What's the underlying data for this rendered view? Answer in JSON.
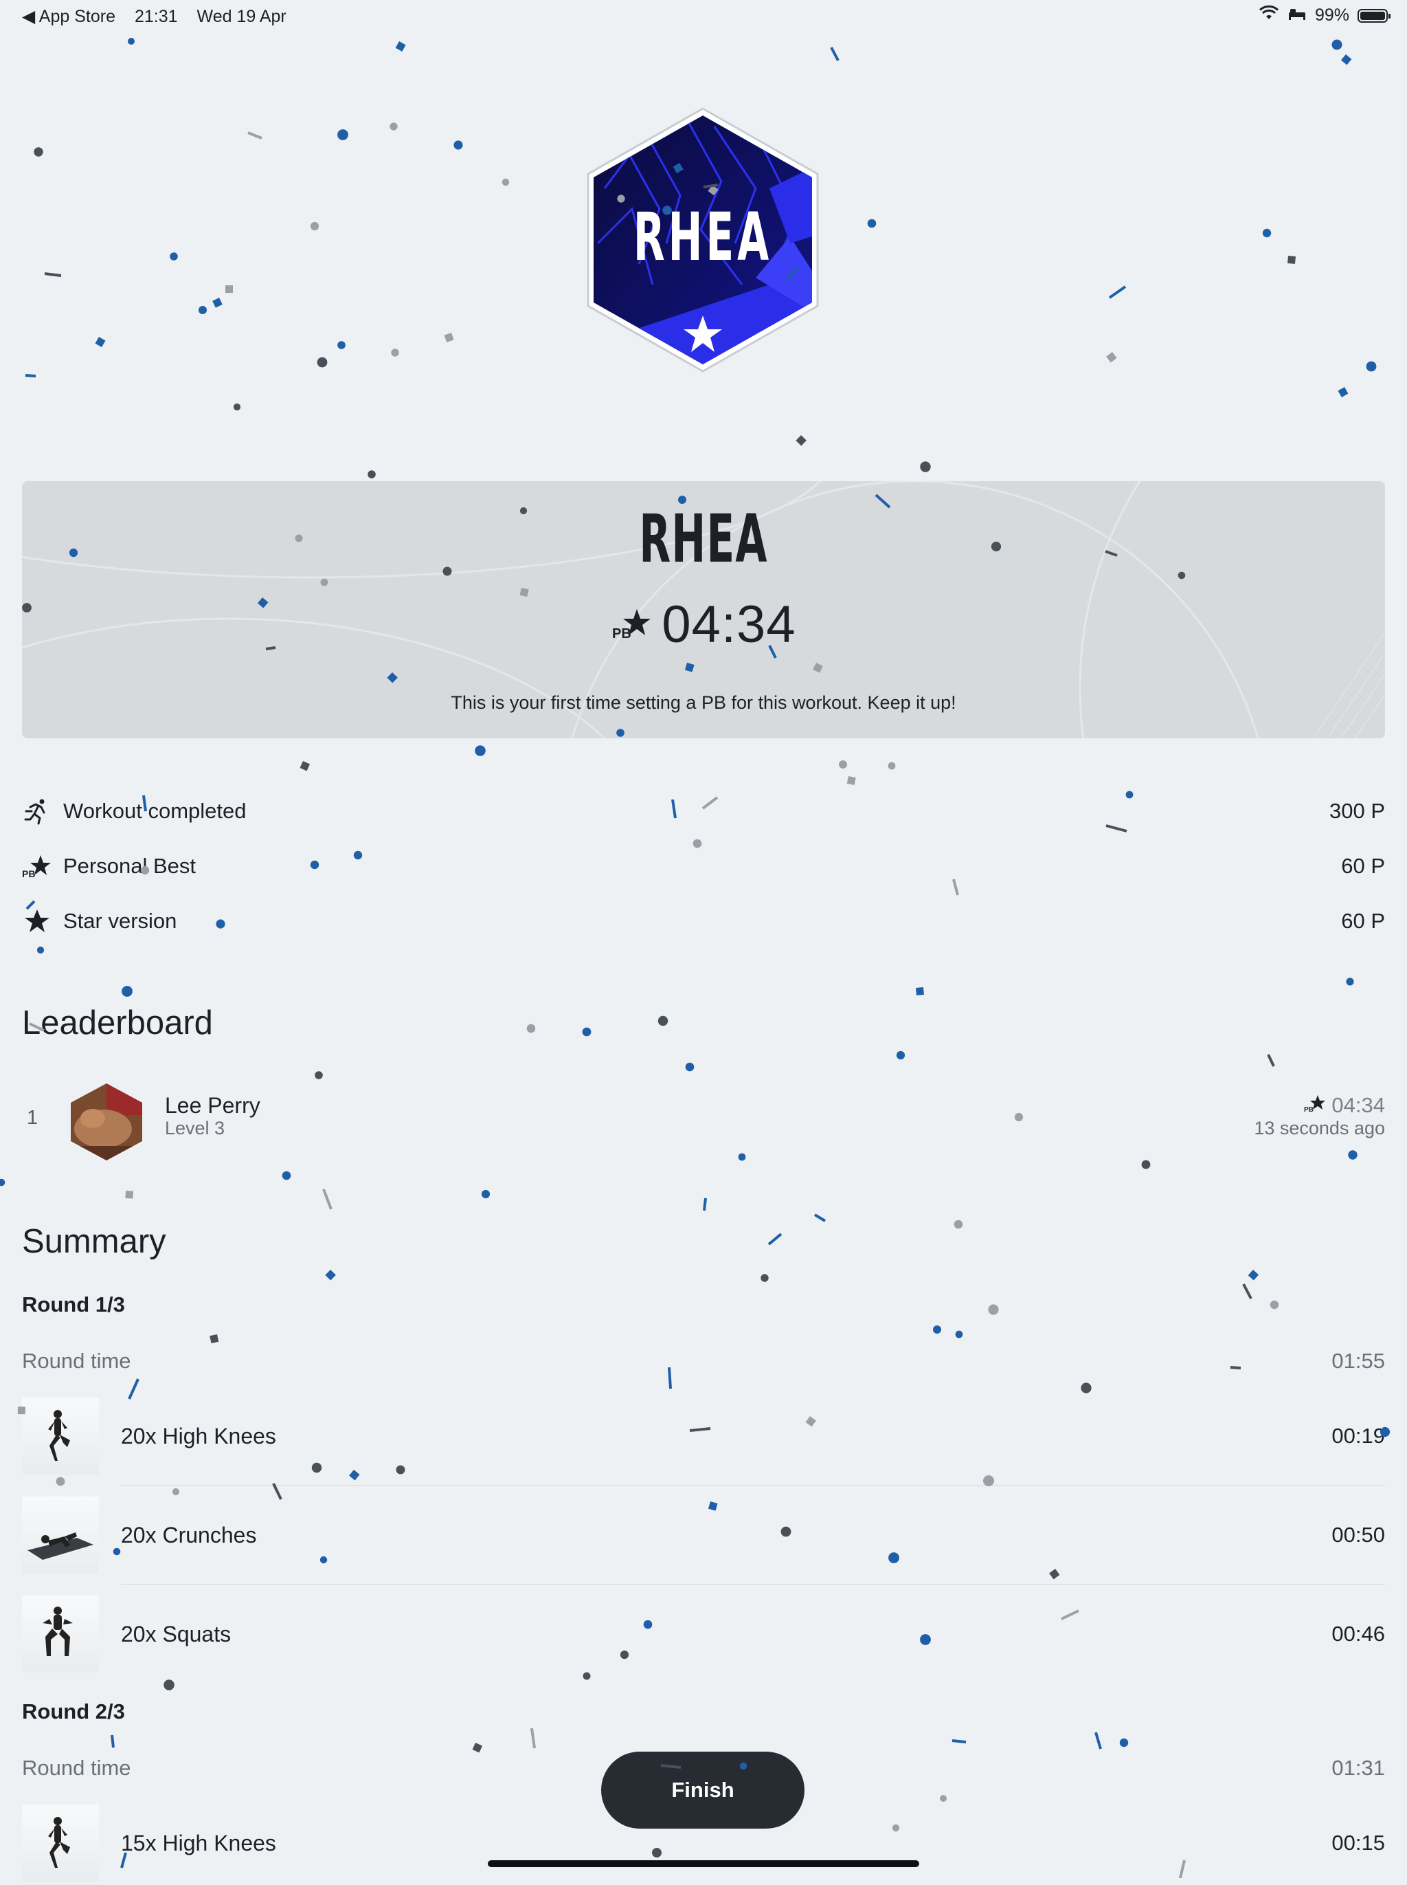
{
  "status_bar": {
    "back_app": "◀ App Store",
    "time": "21:31",
    "date": "Wed 19 Apr",
    "battery": "99%",
    "battery_level": 0.99
  },
  "badge": {
    "name": "RHEA",
    "icon": "star-icon"
  },
  "pb_card": {
    "title": "RHEA",
    "pb_label": "PB",
    "time": "04:34",
    "message": "This is your first time setting a PB for this workout. Keep it up!"
  },
  "points": [
    {
      "icon": "running-person-icon",
      "label": "Workout completed",
      "value": "300 P"
    },
    {
      "icon": "pb-star-icon",
      "label": "Personal Best",
      "value": "60 P"
    },
    {
      "icon": "star-icon",
      "label": "Star version",
      "value": "60 P"
    }
  ],
  "leaderboard": {
    "title": "Leaderboard",
    "entries": [
      {
        "rank": "1",
        "name": "Lee Perry",
        "level": "Level 3",
        "time": "04:34",
        "ago": "13 seconds ago"
      }
    ]
  },
  "summary": {
    "title": "Summary",
    "rounds": [
      {
        "label": "Round 1/3",
        "time_label": "Round time",
        "time": "01:55",
        "exercises": [
          {
            "name": "20x High Knees",
            "time": "00:19"
          },
          {
            "name": "20x Crunches",
            "time": "00:50"
          },
          {
            "name": "20x Squats",
            "time": "00:46"
          }
        ]
      },
      {
        "label": "Round 2/3",
        "time_label": "Round time",
        "time": "01:31",
        "exercises": [
          {
            "name": "15x High Knees",
            "time": "00:15"
          }
        ]
      }
    ]
  },
  "finish_label": "Finish",
  "colors": {
    "accent": "#1f5fa8",
    "badge_blue": "#2a2ee8",
    "dark": "#272c33"
  }
}
